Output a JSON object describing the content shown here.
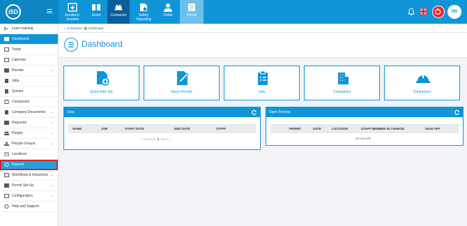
{
  "app": {
    "logo_text": "i5D"
  },
  "topnav": [
    {
      "label": "Accident / Incident",
      "icon": "incident-icon"
    },
    {
      "label": "Asset",
      "icon": "asset-icon"
    },
    {
      "label": "Contractor",
      "icon": "contractor-icon"
    },
    {
      "label": "Safety Reporting",
      "icon": "safety-reporting-icon"
    },
    {
      "label": "Visitor",
      "icon": "visitor-icon"
    },
    {
      "label": "Permit",
      "icon": "permit-icon"
    }
  ],
  "user": {
    "initials": "HD"
  },
  "sidebar": {
    "items": [
      {
        "label": "Learn training",
        "icon": "learn-icon"
      },
      {
        "label": "Dashboard",
        "icon": "dashboard-icon"
      },
      {
        "label": "Today",
        "icon": "today-icon"
      },
      {
        "label": "Calendar",
        "icon": "calendar-icon"
      },
      {
        "label": "Permits",
        "icon": "permits-icon"
      },
      {
        "label": "Jobs",
        "icon": "jobs-icon"
      },
      {
        "label": "Quotes",
        "icon": "quotes-icon"
      },
      {
        "label": "Companies",
        "icon": "companies-icon"
      },
      {
        "label": "Company Documents",
        "icon": "documents-icon"
      },
      {
        "label": "Requests",
        "icon": "requests-icon"
      },
      {
        "label": "People",
        "icon": "people-icon"
      },
      {
        "label": "People Groups",
        "icon": "people-groups-icon"
      },
      {
        "label": "Locations",
        "icon": "locations-icon"
      },
      {
        "label": "Reports",
        "icon": "reports-icon"
      },
      {
        "label": "Workflows & Inductions",
        "icon": "workflows-icon"
      },
      {
        "label": "Permit Set Up",
        "icon": "permit-setup-icon"
      },
      {
        "label": "Configuration",
        "icon": "configuration-icon"
      },
      {
        "label": "Help and Support",
        "icon": "help-icon"
      }
    ]
  },
  "breadcrumb": {
    "root": "Contractor",
    "separator": "/",
    "current": "Dashboard"
  },
  "page": {
    "title": "Dashboard"
  },
  "tiles": [
    {
      "label": "Quick Add Job",
      "icon": "quick-add-job-icon"
    },
    {
      "label": "Open Permits",
      "icon": "open-permits-icon"
    },
    {
      "label": "Jobs",
      "icon": "jobs-clipboard-icon"
    },
    {
      "label": "Companies",
      "icon": "companies-building-icon"
    },
    {
      "label": "Contractors",
      "icon": "hard-hat-icon"
    }
  ],
  "jobs_panel": {
    "title": "Jobs",
    "columns": [
      "NAME",
      "JOB",
      "START DATE",
      "END DATE",
      "STAFF"
    ],
    "pager": {
      "previous": "« Previous",
      "page": "1",
      "next": "Next »"
    }
  },
  "permits_panel": {
    "title": "Open Permits",
    "columns": [
      "PERMIT",
      "DATE",
      "LOCATION",
      "STAFF MEMBER IN CHARGE",
      "SIGN OFF"
    ],
    "empty_text": "No records"
  },
  "colors": {
    "accent": "#0f95d8",
    "nav_active": "#0a5f9a",
    "highlight": "#e02020"
  }
}
